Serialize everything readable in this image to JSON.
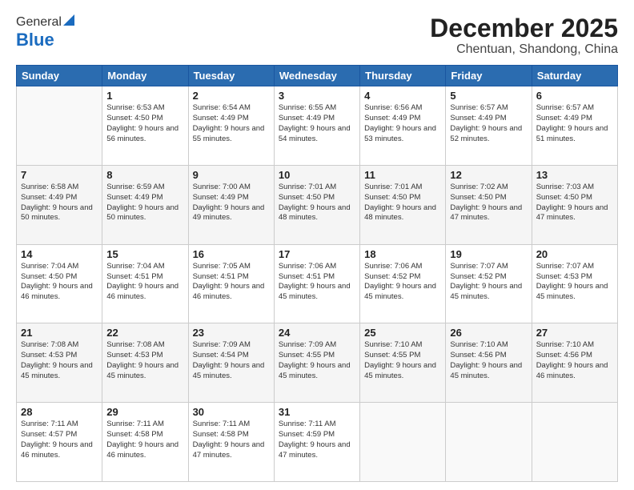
{
  "header": {
    "logo_general": "General",
    "logo_blue": "Blue",
    "month": "December 2025",
    "location": "Chentuan, Shandong, China"
  },
  "days_of_week": [
    "Sunday",
    "Monday",
    "Tuesday",
    "Wednesday",
    "Thursday",
    "Friday",
    "Saturday"
  ],
  "weeks": [
    [
      {
        "day": "",
        "info": ""
      },
      {
        "day": "1",
        "info": "Sunrise: 6:53 AM\nSunset: 4:50 PM\nDaylight: 9 hours\nand 56 minutes."
      },
      {
        "day": "2",
        "info": "Sunrise: 6:54 AM\nSunset: 4:49 PM\nDaylight: 9 hours\nand 55 minutes."
      },
      {
        "day": "3",
        "info": "Sunrise: 6:55 AM\nSunset: 4:49 PM\nDaylight: 9 hours\nand 54 minutes."
      },
      {
        "day": "4",
        "info": "Sunrise: 6:56 AM\nSunset: 4:49 PM\nDaylight: 9 hours\nand 53 minutes."
      },
      {
        "day": "5",
        "info": "Sunrise: 6:57 AM\nSunset: 4:49 PM\nDaylight: 9 hours\nand 52 minutes."
      },
      {
        "day": "6",
        "info": "Sunrise: 6:57 AM\nSunset: 4:49 PM\nDaylight: 9 hours\nand 51 minutes."
      }
    ],
    [
      {
        "day": "7",
        "info": "Sunrise: 6:58 AM\nSunset: 4:49 PM\nDaylight: 9 hours\nand 50 minutes."
      },
      {
        "day": "8",
        "info": "Sunrise: 6:59 AM\nSunset: 4:49 PM\nDaylight: 9 hours\nand 50 minutes."
      },
      {
        "day": "9",
        "info": "Sunrise: 7:00 AM\nSunset: 4:49 PM\nDaylight: 9 hours\nand 49 minutes."
      },
      {
        "day": "10",
        "info": "Sunrise: 7:01 AM\nSunset: 4:50 PM\nDaylight: 9 hours\nand 48 minutes."
      },
      {
        "day": "11",
        "info": "Sunrise: 7:01 AM\nSunset: 4:50 PM\nDaylight: 9 hours\nand 48 minutes."
      },
      {
        "day": "12",
        "info": "Sunrise: 7:02 AM\nSunset: 4:50 PM\nDaylight: 9 hours\nand 47 minutes."
      },
      {
        "day": "13",
        "info": "Sunrise: 7:03 AM\nSunset: 4:50 PM\nDaylight: 9 hours\nand 47 minutes."
      }
    ],
    [
      {
        "day": "14",
        "info": "Sunrise: 7:04 AM\nSunset: 4:50 PM\nDaylight: 9 hours\nand 46 minutes."
      },
      {
        "day": "15",
        "info": "Sunrise: 7:04 AM\nSunset: 4:51 PM\nDaylight: 9 hours\nand 46 minutes."
      },
      {
        "day": "16",
        "info": "Sunrise: 7:05 AM\nSunset: 4:51 PM\nDaylight: 9 hours\nand 46 minutes."
      },
      {
        "day": "17",
        "info": "Sunrise: 7:06 AM\nSunset: 4:51 PM\nDaylight: 9 hours\nand 45 minutes."
      },
      {
        "day": "18",
        "info": "Sunrise: 7:06 AM\nSunset: 4:52 PM\nDaylight: 9 hours\nand 45 minutes."
      },
      {
        "day": "19",
        "info": "Sunrise: 7:07 AM\nSunset: 4:52 PM\nDaylight: 9 hours\nand 45 minutes."
      },
      {
        "day": "20",
        "info": "Sunrise: 7:07 AM\nSunset: 4:53 PM\nDaylight: 9 hours\nand 45 minutes."
      }
    ],
    [
      {
        "day": "21",
        "info": "Sunrise: 7:08 AM\nSunset: 4:53 PM\nDaylight: 9 hours\nand 45 minutes."
      },
      {
        "day": "22",
        "info": "Sunrise: 7:08 AM\nSunset: 4:53 PM\nDaylight: 9 hours\nand 45 minutes."
      },
      {
        "day": "23",
        "info": "Sunrise: 7:09 AM\nSunset: 4:54 PM\nDaylight: 9 hours\nand 45 minutes."
      },
      {
        "day": "24",
        "info": "Sunrise: 7:09 AM\nSunset: 4:55 PM\nDaylight: 9 hours\nand 45 minutes."
      },
      {
        "day": "25",
        "info": "Sunrise: 7:10 AM\nSunset: 4:55 PM\nDaylight: 9 hours\nand 45 minutes."
      },
      {
        "day": "26",
        "info": "Sunrise: 7:10 AM\nSunset: 4:56 PM\nDaylight: 9 hours\nand 45 minutes."
      },
      {
        "day": "27",
        "info": "Sunrise: 7:10 AM\nSunset: 4:56 PM\nDaylight: 9 hours\nand 46 minutes."
      }
    ],
    [
      {
        "day": "28",
        "info": "Sunrise: 7:11 AM\nSunset: 4:57 PM\nDaylight: 9 hours\nand 46 minutes."
      },
      {
        "day": "29",
        "info": "Sunrise: 7:11 AM\nSunset: 4:58 PM\nDaylight: 9 hours\nand 46 minutes."
      },
      {
        "day": "30",
        "info": "Sunrise: 7:11 AM\nSunset: 4:58 PM\nDaylight: 9 hours\nand 47 minutes."
      },
      {
        "day": "31",
        "info": "Sunrise: 7:11 AM\nSunset: 4:59 PM\nDaylight: 9 hours\nand 47 minutes."
      },
      {
        "day": "",
        "info": ""
      },
      {
        "day": "",
        "info": ""
      },
      {
        "day": "",
        "info": ""
      }
    ]
  ]
}
